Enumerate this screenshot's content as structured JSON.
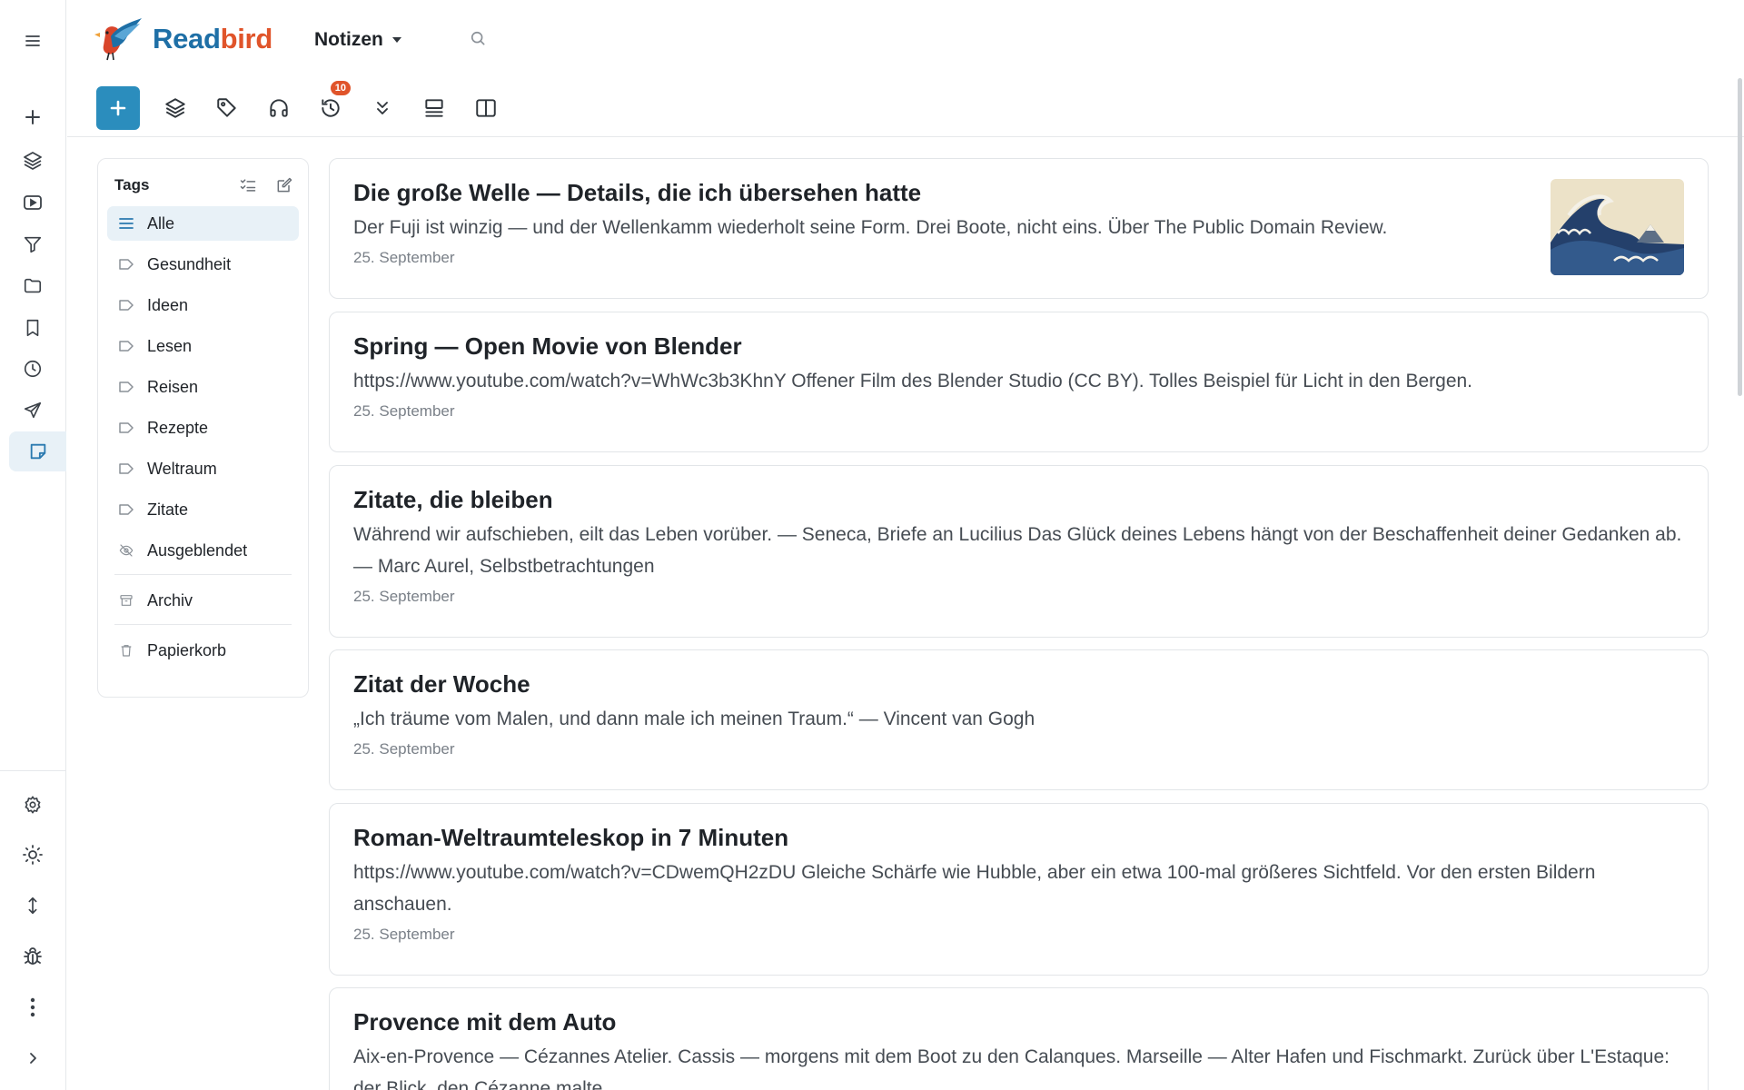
{
  "app": {
    "name_part1": "Read",
    "name_part2": "bird",
    "view_label": "Notizen"
  },
  "colors": {
    "brand_blue": "#1e6fa6",
    "brand_orange": "#e0542a",
    "primary_button": "#2b8dbd",
    "active_bg": "#e8f1f7"
  },
  "rail": {
    "top_items": [
      "menu-icon",
      "plus-icon",
      "layers-icon",
      "video-icon",
      "filter-icon",
      "folder-icon",
      "bookmark-icon",
      "clock-icon",
      "send-icon",
      "note-icon"
    ],
    "active_item": "note-icon",
    "bottom_items": [
      "settings-icon",
      "sun-icon",
      "sort-icon",
      "bug-icon",
      "more-vertical-icon",
      "chevron-right-icon"
    ]
  },
  "toolbar": {
    "items": [
      "add-icon",
      "layers-icon",
      "tag-icon",
      "headphones-icon",
      "history-icon",
      "collapse-icon",
      "list-view-icon",
      "split-view-icon"
    ],
    "history_badge": "10"
  },
  "tags": {
    "title": "Tags",
    "items": [
      {
        "label": "Alle",
        "icon": "list-icon",
        "active": true
      },
      {
        "label": "Gesundheit",
        "icon": "tag-icon"
      },
      {
        "label": "Ideen",
        "icon": "tag-icon"
      },
      {
        "label": "Lesen",
        "icon": "tag-icon"
      },
      {
        "label": "Reisen",
        "icon": "tag-icon"
      },
      {
        "label": "Rezepte",
        "icon": "tag-icon"
      },
      {
        "label": "Weltraum",
        "icon": "tag-icon"
      },
      {
        "label": "Zitate",
        "icon": "tag-icon"
      },
      {
        "label": "Ausgeblendet",
        "icon": "eye-off-icon"
      }
    ],
    "archive": "Archiv",
    "trash": "Papierkorb"
  },
  "notes": [
    {
      "title": "Die große Welle — Details, die ich übersehen hatte",
      "body": "Der Fuji ist winzig — und der Wellenkamm wiederholt seine Form. Drei Boote, nicht eins. Über The Public Domain Review.",
      "date": "25. September",
      "has_thumbnail": true
    },
    {
      "title": "Spring — Open Movie von Blender",
      "body": "https://www.youtube.com/watch?v=WhWc3b3KhnY Offener Film des Blender Studio (CC BY). Tolles Beispiel für Licht in den Bergen.",
      "date": "25. September"
    },
    {
      "title": "Zitate, die bleiben",
      "body": "Während wir aufschieben, eilt das Leben vorüber. — Seneca, Briefe an Lucilius Das Glück deines Lebens hängt von der Beschaffenheit deiner Gedanken ab. — Marc Aurel, Selbstbetrachtungen",
      "date": "25. September"
    },
    {
      "title": "Zitat der Woche",
      "body": "„Ich träume vom Malen, und dann male ich meinen Traum.“ — Vincent van Gogh",
      "date": "25. September"
    },
    {
      "title": "Roman-Weltraumteleskop in 7 Minuten",
      "body": "https://www.youtube.com/watch?v=CDwemQH2zDU Gleiche Schärfe wie Hubble, aber ein etwa 100-mal größeres Sichtfeld. Vor den ersten Bildern anschauen.",
      "date": "25. September"
    },
    {
      "title": "Provence mit dem Auto",
      "body": "Aix-en-Provence — Cézannes Atelier. Cassis — morgens mit dem Boot zu den Calanques. Marseille — Alter Hafen und Fischmarkt. Zurück über L'Estaque: der Blick, den Cézanne malte.",
      "date": ""
    }
  ]
}
